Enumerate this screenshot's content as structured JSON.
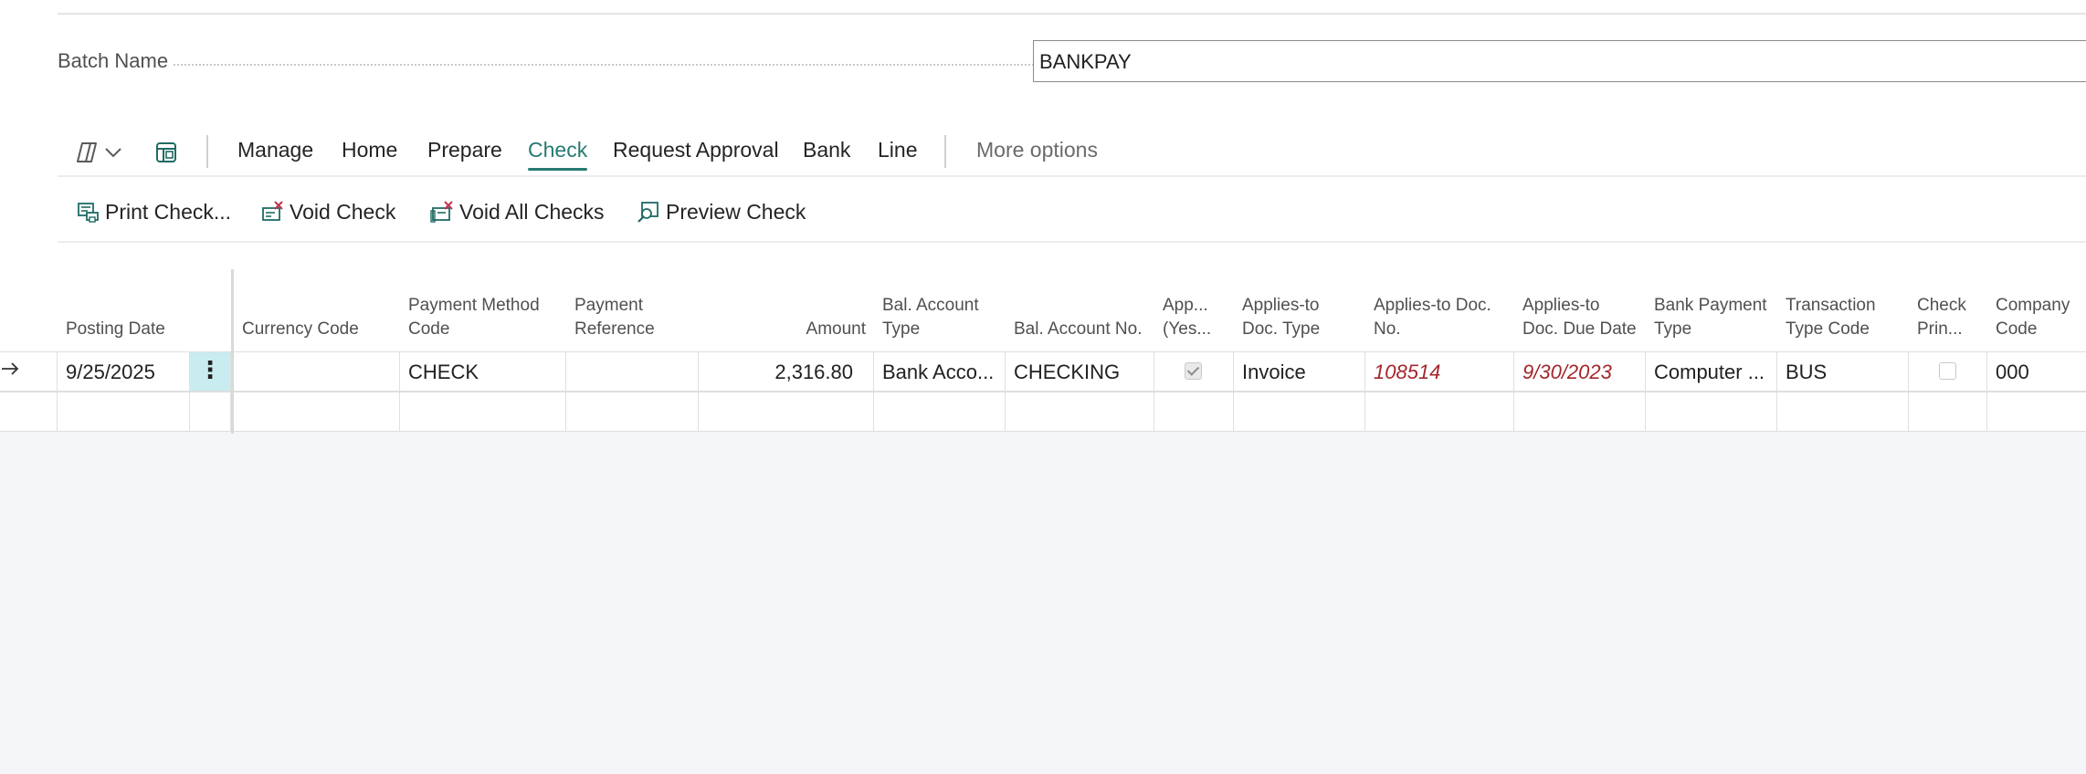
{
  "batch": {
    "label": "Batch Name",
    "value": "BANKPAY"
  },
  "action_bar": {
    "items": [
      "Manage",
      "Home",
      "Prepare",
      "Check",
      "Request Approval",
      "Bank",
      "Line"
    ],
    "active": "Check",
    "more": "More options"
  },
  "sub_actions": [
    "Print Check...",
    "Void Check",
    "Void All Checks",
    "Preview Check"
  ],
  "table": {
    "headers": {
      "posting_date": "Posting Date",
      "currency_code": "Currency Code",
      "payment_method_code": "Payment Method Code",
      "payment_reference": "Payment Reference",
      "amount": "Amount",
      "bal_account_type": "Bal. Account Type",
      "bal_account_no": "Bal. Account No.",
      "app_yes": "App... (Yes...",
      "applies_to_doc_type": "Applies-to Doc. Type",
      "applies_to_doc_no": "Applies-to Doc. No.",
      "applies_to_doc_due_date": "Applies-to Doc. Due Date",
      "bank_payment_type": "Bank Payment Type",
      "transaction_type_code": "Transaction Type Code",
      "check_printed": "Check Prin...",
      "company_code": "Company Code"
    },
    "row": {
      "posting_date": "9/25/2025",
      "currency_code": "",
      "payment_method_code": "CHECK",
      "payment_reference": "",
      "amount": "2,316.80",
      "bal_account_type": "Bank Acco...",
      "bal_account_no": "CHECKING",
      "app_yes": true,
      "applies_to_doc_type": "Invoice",
      "applies_to_doc_no": "108514",
      "applies_to_doc_due_date": "9/30/2023",
      "bank_payment_type": "Computer ...",
      "transaction_type_code": "BUS",
      "check_printed": false,
      "company_code": "000"
    }
  },
  "colors": {
    "accent": "#267a71",
    "error_text": "#a4262c",
    "selected_cell": "#c8ecef"
  }
}
